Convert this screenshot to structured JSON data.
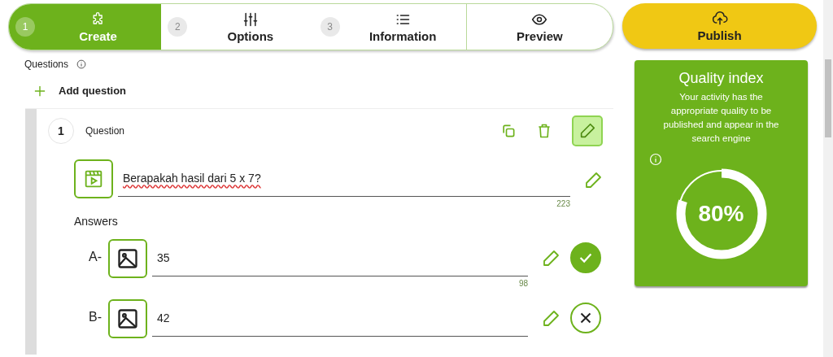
{
  "steps": [
    {
      "number": "1",
      "label": "Create",
      "selected": true
    },
    {
      "number": "2",
      "label": "Options",
      "selected": false
    },
    {
      "number": "3",
      "label": "Information",
      "selected": false
    },
    {
      "label": "Preview",
      "selected": false
    }
  ],
  "publish_button": {
    "label": "Publish"
  },
  "questions_label": "Questions",
  "add_question": "Add question",
  "question": {
    "number": "1",
    "label": "Question",
    "text": "Berapakah hasil dari 5 x 7?",
    "count": "223",
    "answers_label": "Answers",
    "answers": [
      {
        "letter": "A-",
        "text": "35",
        "count": "98",
        "correct": true
      },
      {
        "letter": "B-",
        "text": "42",
        "correct": false
      }
    ]
  },
  "quality": {
    "title": "Quality index",
    "description": "Your activity has the appropriate quality to be published and appear in the search engine",
    "value": "80%",
    "level": 0.8
  }
}
